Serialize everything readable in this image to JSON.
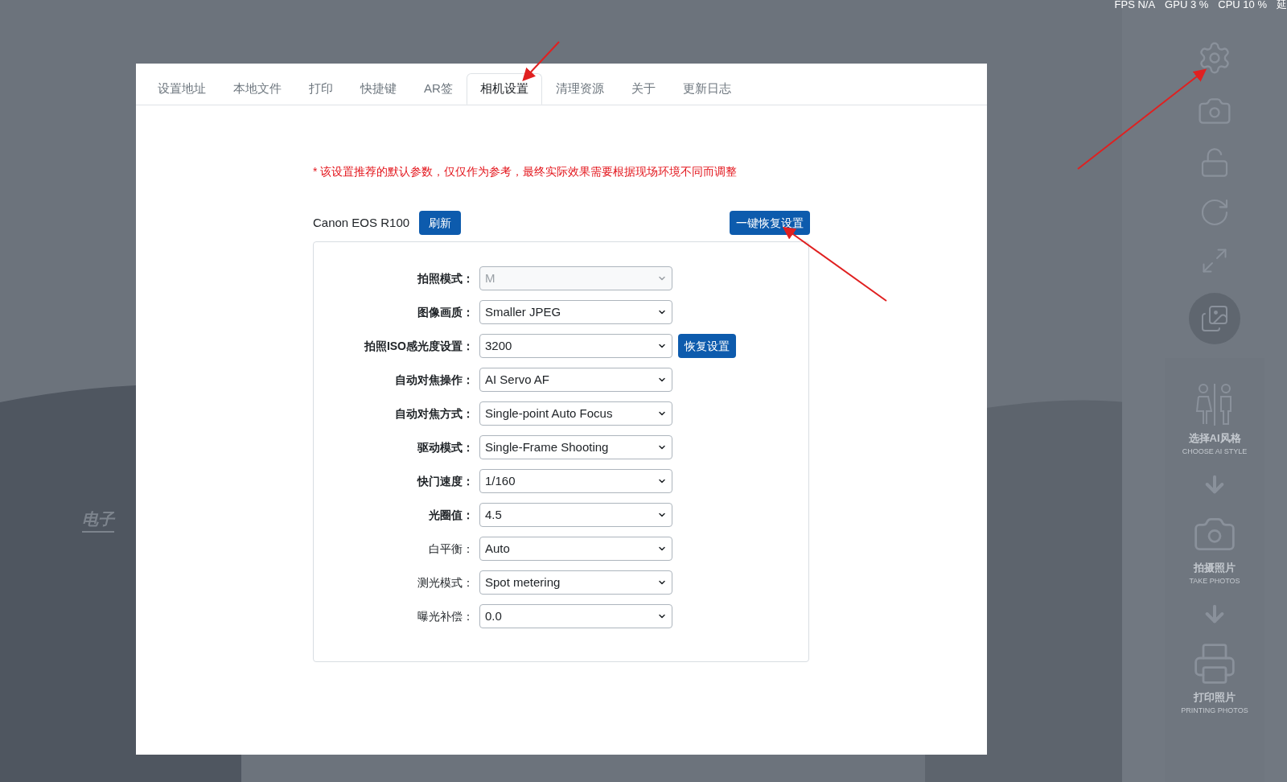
{
  "status_bar": [
    "FPS N/A",
    "GPU 3 %",
    "CPU 10 %",
    "延"
  ],
  "background_logo": "电子",
  "tabs": [
    {
      "label": "设置地址",
      "selected": false
    },
    {
      "label": "本地文件",
      "selected": false
    },
    {
      "label": "打印",
      "selected": false
    },
    {
      "label": "快捷键",
      "selected": false
    },
    {
      "label": "AR签",
      "selected": false
    },
    {
      "label": "相机设置",
      "selected": true
    },
    {
      "label": "清理资源",
      "selected": false
    },
    {
      "label": "关于",
      "selected": false
    },
    {
      "label": "更新日志",
      "selected": false
    }
  ],
  "notice": "* 该设置推荐的默认参数，仅仅作为参考，最终实际效果需要根据现场环境不同而调整",
  "camera": {
    "name": "Canon EOS R100",
    "refresh_button": "刷新",
    "reset_all_button": "一键恢复设置"
  },
  "fields": [
    {
      "label": "拍照模式：",
      "value": "M",
      "emphasized": true,
      "disabled": true
    },
    {
      "label": "图像画质：",
      "value": "Smaller JPEG",
      "emphasized": true,
      "disabled": false
    },
    {
      "label": "拍照ISO感光度设置：",
      "value": "3200",
      "emphasized": true,
      "disabled": false,
      "button": "恢复设置"
    },
    {
      "label": "自动对焦操作：",
      "value": "AI Servo AF",
      "emphasized": true,
      "disabled": false
    },
    {
      "label": "自动对焦方式：",
      "value": "Single-point Auto Focus",
      "emphasized": true,
      "disabled": false
    },
    {
      "label": "驱动模式：",
      "value": "Single-Frame Shooting",
      "emphasized": true,
      "disabled": false
    },
    {
      "label": "快门速度：",
      "value": "1/160",
      "emphasized": true,
      "disabled": false
    },
    {
      "label": "光圈值：",
      "value": "4.5",
      "emphasized": true,
      "disabled": false
    },
    {
      "label": "白平衡：",
      "value": "Auto",
      "emphasized": false,
      "disabled": false
    },
    {
      "label": "测光模式：",
      "value": "Spot metering",
      "emphasized": false,
      "disabled": false
    },
    {
      "label": "曝光补偿：",
      "value": "0.0",
      "emphasized": false,
      "disabled": false
    }
  ],
  "steps": [
    {
      "kind": "style",
      "title": "选择AI风格",
      "subtitle": "CHOOSE AI STYLE"
    },
    {
      "kind": "photo",
      "title": "拍摄照片",
      "subtitle": "TAKE PHOTOS"
    },
    {
      "kind": "print",
      "title": "打印照片",
      "subtitle": "PRINTING PHOTOS"
    }
  ]
}
